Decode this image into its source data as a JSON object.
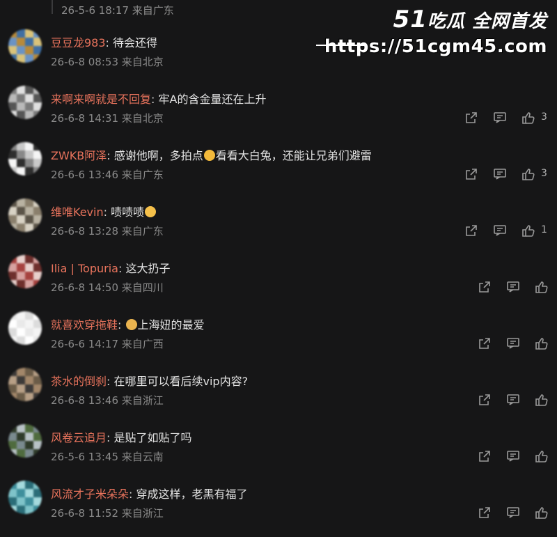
{
  "top_meta": "26-5-6 18:17 来自广东",
  "watermark": {
    "brand_num": "51",
    "brand_text": "吃瓜 全网首发",
    "url": "https://51cgm45.com"
  },
  "comments": [
    {
      "user": "豆豆龙983",
      "text": "待会还得",
      "time": "26-6-8 08:53 来自北京",
      "likes": "",
      "avatar_colors": [
        "#b88a3a",
        "#6a93c4",
        "#d9c37a",
        "#3f6fa3"
      ],
      "show_actions": false
    },
    {
      "user": "来啊来啊就是不回复",
      "text": "牢A的含金量还在上升",
      "time": "26-6-8 14:31 来自北京",
      "likes": "3",
      "avatar_colors": [
        "#e0e0e0",
        "#7a7a7a",
        "#b9b9b9",
        "#555555"
      ],
      "show_actions": true
    },
    {
      "user": "ZWKB阿泽",
      "text_pre": "感谢他啊，多拍点",
      "emoji_color": "#f2b93b",
      "text_post": "看看大白兔，还能让兄弟们避雷",
      "time": "26-6-6 13:46 来自广东",
      "likes": "3",
      "avatar_colors": [
        "#f5f5f5",
        "#c9c9c9",
        "#888888",
        "#2e2e2e"
      ],
      "show_actions": true
    },
    {
      "user": "维唯Kevin",
      "text_pre": "啧啧啧",
      "emoji_color": "#f5c04a",
      "text_post": "",
      "time": "26-6-8 13:28 来自广东",
      "likes": "1",
      "avatar_colors": [
        "#d8d2c4",
        "#8a7f6c",
        "#b9b2a2",
        "#5b5448"
      ],
      "show_actions": true
    },
    {
      "user": "Ilia | Topuria",
      "text": "这大扔子",
      "time": "26-6-8 14:50 来自四川",
      "likes": "",
      "avatar_colors": [
        "#a6423f",
        "#d7a2a0",
        "#6e2f2c",
        "#e8d0cc"
      ],
      "show_actions": true
    },
    {
      "user": "就喜欢穿拖鞋",
      "text_pre": "",
      "emoji_color": "#e9b34f",
      "text_post": "上海妞的最爱",
      "time": "26-6-6 14:17 来自广西",
      "likes": "",
      "avatar_colors": [
        "#f4f4f4",
        "#e9e9e9",
        "#ffffff",
        "#dcdcdc"
      ],
      "show_actions": true
    },
    {
      "user": "茶水的倒刹",
      "text": "在哪里可以看后续vip内容?",
      "time": "26-6-8 13:46 来自浙江",
      "likes": "",
      "avatar_colors": [
        "#6b5c48",
        "#a3876a",
        "#3d3a38",
        "#b79f86"
      ],
      "show_actions": true
    },
    {
      "user": "风卷云追月",
      "text": "是贴了如贴了吗",
      "time": "26-5-6 13:45 来自云南",
      "likes": "",
      "avatar_colors": [
        "#7a8a8f",
        "#4f6b3e",
        "#b8c2c6",
        "#2f3b2a"
      ],
      "show_actions": true
    },
    {
      "user": "风流才子米朵朵",
      "text": "穿成这样，老黑有福了",
      "time": "26-6-8 11:52 来自浙江",
      "likes": "",
      "avatar_colors": [
        "#3e8f9c",
        "#7fc3c9",
        "#2b6d78",
        "#a5dadd"
      ],
      "show_actions": true
    }
  ],
  "icons": {
    "share": "share-icon",
    "comment": "comment-icon",
    "like": "like-icon"
  }
}
